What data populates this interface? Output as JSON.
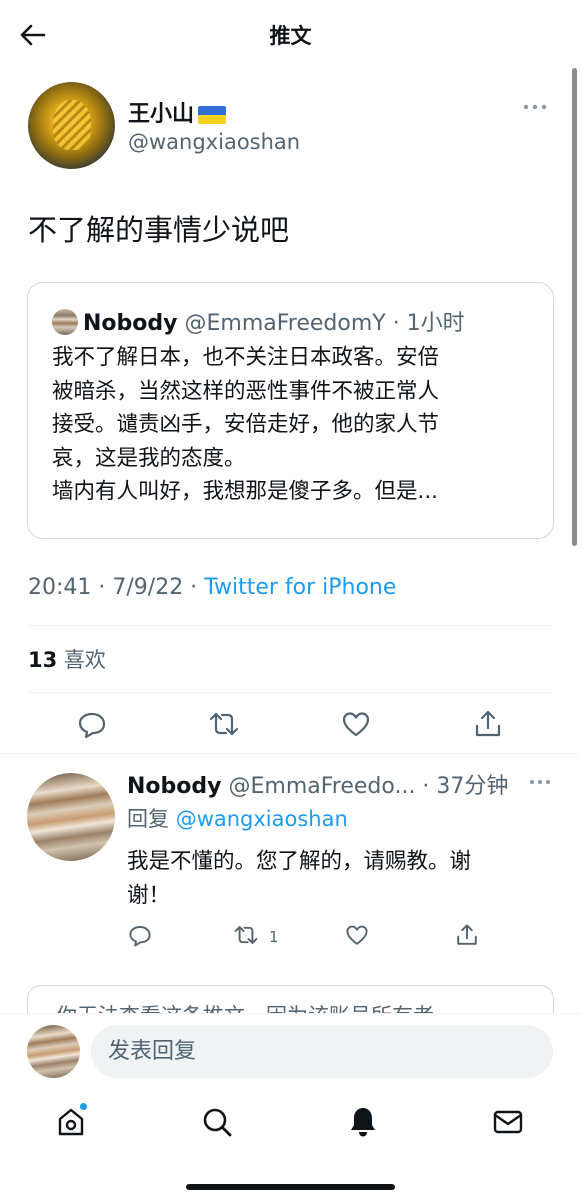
{
  "header": {
    "title": "推文"
  },
  "tweet": {
    "author_name": "王小山",
    "author_handle": "@wangxiaoshan",
    "text": "不了解的事情少说吧",
    "time": "20:41 · 7/9/22 · ",
    "source": "Twitter for iPhone",
    "likes_count": "13",
    "likes_label": "喜欢"
  },
  "quote": {
    "name": "Nobody",
    "handle": "@EmmaFreedomY · 1小时",
    "lines": [
      "我不了解日本，也不关注日本政客。安倍",
      "被暗杀，当然这样的恶性事件不被正常人",
      "接受。谴责凶手，安倍走好，他的家人节",
      "哀，这是我的态度。",
      "墙内有人叫好，我想那是傻子多。但是..."
    ]
  },
  "reply": {
    "name": "Nobody",
    "handle": "@EmmaFreedo... · 37分钟",
    "replying_label": "回复 ",
    "replying_to": "@wangxiaoshan",
    "lines": [
      "我是不懂的。您了解的，请赐教。谢",
      "谢！"
    ],
    "retweet_count": "1"
  },
  "notice": {
    "text": "你无法查看这条推文，因为该账号所有者"
  },
  "compose": {
    "placeholder": "发表回复"
  },
  "colors": {
    "accent": "#1d9bf0",
    "text": "#0f1419",
    "muted": "#536471",
    "border": "#cfd9de"
  }
}
